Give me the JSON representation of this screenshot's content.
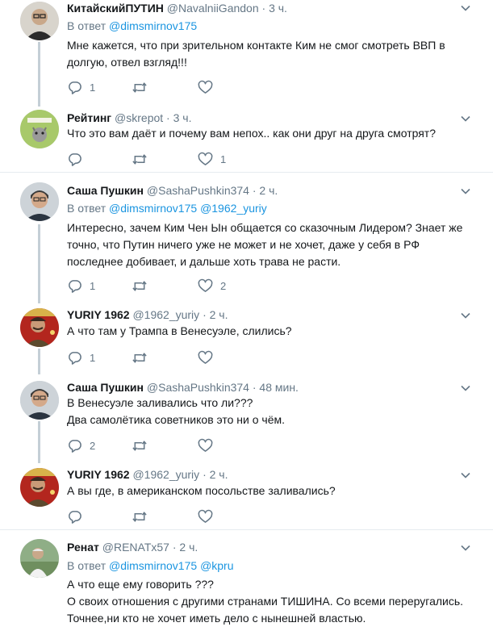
{
  "tweets": [
    {
      "name": "КитайскийПУТИН",
      "handle": "@NavalniiGandon",
      "time": "· 3 ч.",
      "reply_prefix": "В ответ",
      "mentions": [
        "@dimsmirnov175"
      ],
      "lines": [
        "Мне кажется, что при зрительном контакте Ким не смог смотреть ВВП в",
        "долгую, отвел взгляд!!!"
      ],
      "reply_count": "1",
      "retweet_count": "",
      "like_count": "",
      "avatar": "man-in-glasses-avatar"
    },
    {
      "name": "Рейтинг",
      "handle": "@skrepot",
      "time": "· 3 ч.",
      "lines": [
        "Что это вам даёт и почему вам непох.. как они  друг на друга смотрят?"
      ],
      "reply_count": "",
      "retweet_count": "",
      "like_count": "1",
      "avatar": "cartoon-cat-avatar"
    },
    {
      "name": "Саша Пушкин",
      "handle": "@SashaPushkin374",
      "time": "· 2 ч.",
      "reply_prefix": "В ответ",
      "mentions": [
        "@dimsmirnov175",
        "@1962_yuriy"
      ],
      "lines": [
        "Интересно, зачем Ким Чен Ын общается со сказочным Лидером? Знает же",
        "точно, что Путин ничего уже не может и не хочет, даже у себя в РФ",
        "последнее добивает, и дальше хоть трава не расти."
      ],
      "reply_count": "1",
      "retweet_count": "",
      "like_count": "2",
      "avatar": "man-portrait-avatar"
    },
    {
      "name": "YURIY 1962",
      "handle": "@1962_yuriy",
      "time": "· 2 ч.",
      "lines": [
        "А что там у Трампа в Венесуэле, слились?"
      ],
      "reply_count": "1",
      "retweet_count": "",
      "like_count": "",
      "avatar": "stalin-poster-avatar"
    },
    {
      "name": "Саша Пушкин",
      "handle": "@SashaPushkin374",
      "time": "· 48 мин.",
      "lines": [
        "В Венесуэле заливались что ли???",
        "Два самолётика советников это ни о чём."
      ],
      "reply_count": "2",
      "retweet_count": "",
      "like_count": "",
      "avatar": "man-portrait-avatar"
    },
    {
      "name": "YURIY 1962",
      "handle": "@1962_yuriy",
      "time": "· 2 ч.",
      "lines": [
        "А вы где, в американском посольстве заливались?"
      ],
      "reply_count": "",
      "retweet_count": "",
      "like_count": "",
      "avatar": "stalin-poster-avatar"
    },
    {
      "name": "Ренат",
      "handle": "@RENATx57",
      "time": "· 2 ч.",
      "reply_prefix": "В ответ",
      "mentions": [
        "@dimsmirnov175",
        "@kpru"
      ],
      "lines": [
        "А что еще ему говорить ???",
        "О своих отношения с другими странами ТИШИНА. Со всеми переругались.",
        "Точнее,ни кто не хочет иметь дело с нынешней властью."
      ],
      "reply_count": "",
      "retweet_count": "",
      "like_count": "",
      "avatar": "man-outdoors-avatar"
    }
  ]
}
